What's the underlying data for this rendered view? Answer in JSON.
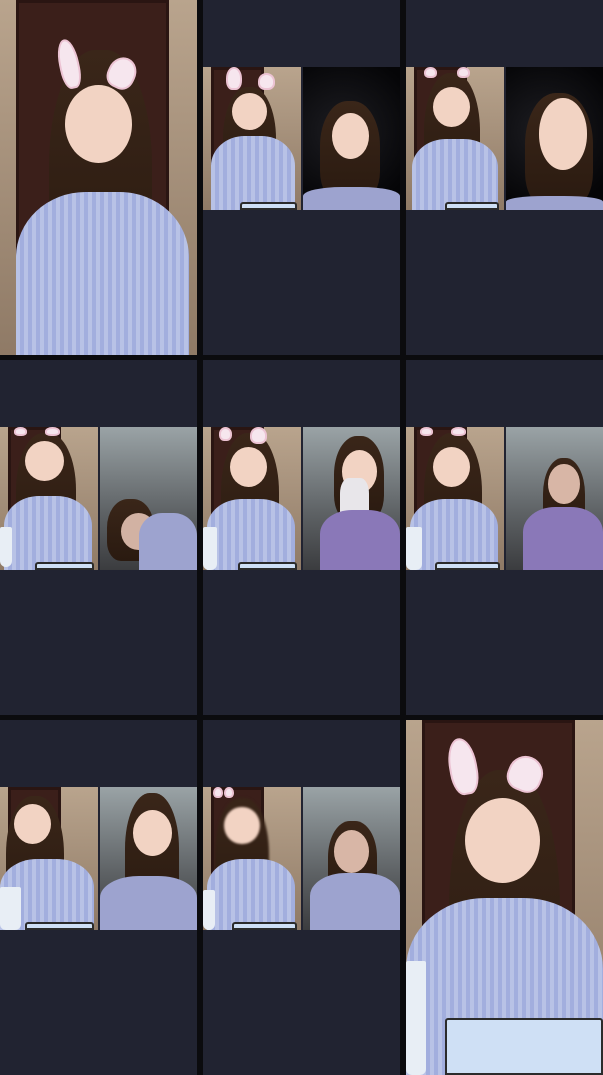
{
  "screen": {
    "type": "multi-guest-live-video-grid",
    "background_color": "#0b0b0e",
    "tile_color": "#212331"
  },
  "tiles": [
    {
      "id": 1,
      "layout": "full",
      "panes": [
        "host-camera"
      ],
      "overlay": "bunny-ears-filter",
      "watermark": ""
    },
    {
      "id": 2,
      "layout": "split-strip",
      "panes": [
        "host-camera",
        "guest-camera"
      ],
      "overlay": "bunny-ears-filter"
    },
    {
      "id": 3,
      "layout": "split-strip",
      "panes": [
        "host-camera",
        "guest-camera"
      ],
      "overlay": "bunny-ears-filter"
    },
    {
      "id": 4,
      "layout": "split-strip",
      "panes": [
        "host-camera",
        "guest-camera"
      ],
      "overlay": "bunny-ears-filter"
    },
    {
      "id": 5,
      "layout": "split-strip",
      "panes": [
        "host-camera",
        "guest-camera"
      ],
      "overlay": "bunny-ears-filter"
    },
    {
      "id": 6,
      "layout": "split-strip",
      "panes": [
        "host-camera",
        "guest-camera"
      ],
      "overlay": "bunny-ears-filter"
    },
    {
      "id": 7,
      "layout": "split-strip",
      "panes": [
        "host-camera",
        "guest-camera"
      ],
      "overlay": "bunny-ears-filter"
    },
    {
      "id": 8,
      "layout": "split-strip",
      "panes": [
        "host-camera",
        "guest-camera"
      ],
      "overlay": "bunny-ears-filter"
    },
    {
      "id": 9,
      "layout": "full",
      "panes": [
        "host-camera"
      ],
      "overlay": "bunny-ears-filter"
    }
  ]
}
